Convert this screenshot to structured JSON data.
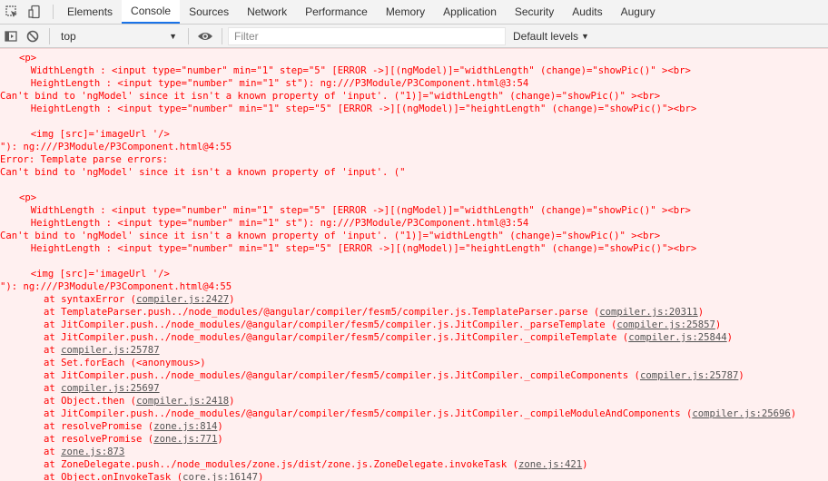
{
  "tabs": [
    "Elements",
    "Console",
    "Sources",
    "Network",
    "Performance",
    "Memory",
    "Application",
    "Security",
    "Audits",
    "Augury"
  ],
  "active_tab": "Console",
  "toolbar": {
    "context": "top",
    "filter_placeholder": "Filter",
    "levels": "Default levels"
  },
  "icons": {
    "inspect": "inspect-element-icon",
    "device": "device-toolbar-icon",
    "sidebar": "show-sidebar-icon",
    "clear": "clear-console-icon",
    "eye": "live-expression-eye-icon",
    "dropdown": "chevron-down-icon"
  },
  "colors": {
    "error_text": "#ff0000",
    "error_bg": "#fff0f0",
    "link": "#545454",
    "tab_active": "#1a73e8"
  },
  "console_lines": [
    {
      "t": "<p>",
      "indent": 0
    },
    {
      "t": "  WidthLength : <input type=\"number\" min=\"1\" step=\"5\" [ERROR ->][(ngModel)]=\"widthLength\" (change)=\"showPic()\" ><br>",
      "indent": 0
    },
    {
      "t": "  HeightLength : <input type=\"number\" min=\"1\" st\"): ng:///P3Module/P3Component.html@3:54",
      "indent": 0
    },
    {
      "t": "Can't bind to 'ngModel' since it isn't a known property of 'input'. (\"1)]=\"widthLength\" (change)=\"showPic()\" ><br>",
      "indent": -1
    },
    {
      "t": "  HeightLength : <input type=\"number\" min=\"1\" step=\"5\" [ERROR ->][(ngModel)]=\"heightLength\" (change)=\"showPic()\"><br>",
      "indent": 0
    },
    {
      "t": "",
      "indent": 0
    },
    {
      "t": "  <img [src]='imageUrl '/>",
      "indent": 0
    },
    {
      "t": "\"): ng:///P3Module/P3Component.html@4:55",
      "indent": -1
    },
    {
      "t": "Error: Template parse errors:",
      "indent": -1
    },
    {
      "t": "Can't bind to 'ngModel' since it isn't a known property of 'input'. (\"",
      "indent": -1
    },
    {
      "t": "",
      "indent": 0
    },
    {
      "t": "<p>",
      "indent": 0
    },
    {
      "t": "  WidthLength : <input type=\"number\" min=\"1\" step=\"5\" [ERROR ->][(ngModel)]=\"widthLength\" (change)=\"showPic()\" ><br>",
      "indent": 0
    },
    {
      "t": "  HeightLength : <input type=\"number\" min=\"1\" st\"): ng:///P3Module/P3Component.html@3:54",
      "indent": 0
    },
    {
      "t": "Can't bind to 'ngModel' since it isn't a known property of 'input'. (\"1)]=\"widthLength\" (change)=\"showPic()\" ><br>",
      "indent": -1
    },
    {
      "t": "  HeightLength : <input type=\"number\" min=\"1\" step=\"5\" [ERROR ->][(ngModel)]=\"heightLength\" (change)=\"showPic()\"><br>",
      "indent": 0
    },
    {
      "t": "",
      "indent": 0
    },
    {
      "t": "  <img [src]='imageUrl '/>",
      "indent": 0
    },
    {
      "t": "\"): ng:///P3Module/P3Component.html@4:55",
      "indent": -1
    }
  ],
  "stack": [
    {
      "pre": "at syntaxError (",
      "link": "compiler.js:2427",
      "post": ")"
    },
    {
      "pre": "at TemplateParser.push../node_modules/@angular/compiler/fesm5/compiler.js.TemplateParser.parse (",
      "link": "compiler.js:20311",
      "post": ")"
    },
    {
      "pre": "at JitCompiler.push../node_modules/@angular/compiler/fesm5/compiler.js.JitCompiler._parseTemplate (",
      "link": "compiler.js:25857",
      "post": ")"
    },
    {
      "pre": "at JitCompiler.push../node_modules/@angular/compiler/fesm5/compiler.js.JitCompiler._compileTemplate (",
      "link": "compiler.js:25844",
      "post": ")"
    },
    {
      "pre": "at ",
      "link": "compiler.js:25787",
      "post": ""
    },
    {
      "pre": "at Set.forEach (<anonymous>)",
      "link": "",
      "post": ""
    },
    {
      "pre": "at JitCompiler.push../node_modules/@angular/compiler/fesm5/compiler.js.JitCompiler._compileComponents (",
      "link": "compiler.js:25787",
      "post": ")"
    },
    {
      "pre": "at ",
      "link": "compiler.js:25697",
      "post": ""
    },
    {
      "pre": "at Object.then (",
      "link": "compiler.js:2418",
      "post": ")"
    },
    {
      "pre": "at JitCompiler.push../node_modules/@angular/compiler/fesm5/compiler.js.JitCompiler._compileModuleAndComponents (",
      "link": "compiler.js:25696",
      "post": ")"
    },
    {
      "pre": "at resolvePromise (",
      "link": "zone.js:814",
      "post": ")"
    },
    {
      "pre": "at resolvePromise (",
      "link": "zone.js:771",
      "post": ")"
    },
    {
      "pre": "at ",
      "link": "zone.js:873",
      "post": ""
    },
    {
      "pre": "at ZoneDelegate.push../node_modules/zone.js/dist/zone.js.ZoneDelegate.invokeTask (",
      "link": "zone.js:421",
      "post": ")"
    },
    {
      "pre": "at Object.onInvokeTask (",
      "link": "core.js:16147",
      "post": ")"
    }
  ]
}
